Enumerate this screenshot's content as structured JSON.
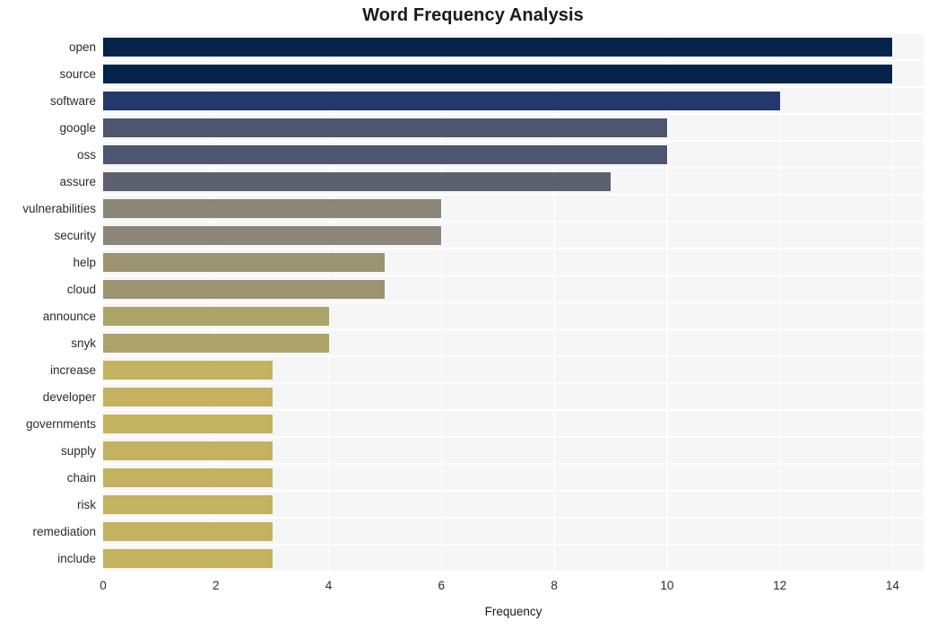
{
  "chart_data": {
    "type": "bar",
    "orientation": "horizontal",
    "title": "Word Frequency Analysis",
    "xlabel": "Frequency",
    "ylabel": "",
    "categories": [
      "open",
      "source",
      "software",
      "google",
      "oss",
      "assure",
      "vulnerabilities",
      "security",
      "help",
      "cloud",
      "announce",
      "snyk",
      "increase",
      "developer",
      "governments",
      "supply",
      "chain",
      "risk",
      "remediation",
      "include"
    ],
    "values": [
      14,
      14,
      12,
      10,
      10,
      9,
      6,
      6,
      5,
      5,
      4,
      4,
      3,
      3,
      3,
      3,
      3,
      3,
      3,
      3
    ],
    "bar_colors": [
      "#05234b",
      "#05234b",
      "#23396e",
      "#4d5571",
      "#4d5571",
      "#5d606e",
      "#8b8678",
      "#8b8678",
      "#9c9470",
      "#9c9470",
      "#aca368",
      "#aca368",
      "#c3b25f",
      "#c3b25f",
      "#c3b25f",
      "#c3b25f",
      "#c3b25f",
      "#c3b25f",
      "#c3b25f",
      "#c3b25f"
    ],
    "xlim": [
      0,
      14.55
    ],
    "xticks": [
      0,
      2,
      4,
      6,
      8,
      10,
      12,
      14
    ],
    "xtick_labels": [
      "0",
      "2",
      "4",
      "6",
      "8",
      "10",
      "12",
      "14"
    ],
    "grid": true,
    "grid_color": "#ffffff",
    "plot_background": "#f6f6f7",
    "figure_background": "#ffffff",
    "legend": null,
    "colormap": "cividis"
  }
}
